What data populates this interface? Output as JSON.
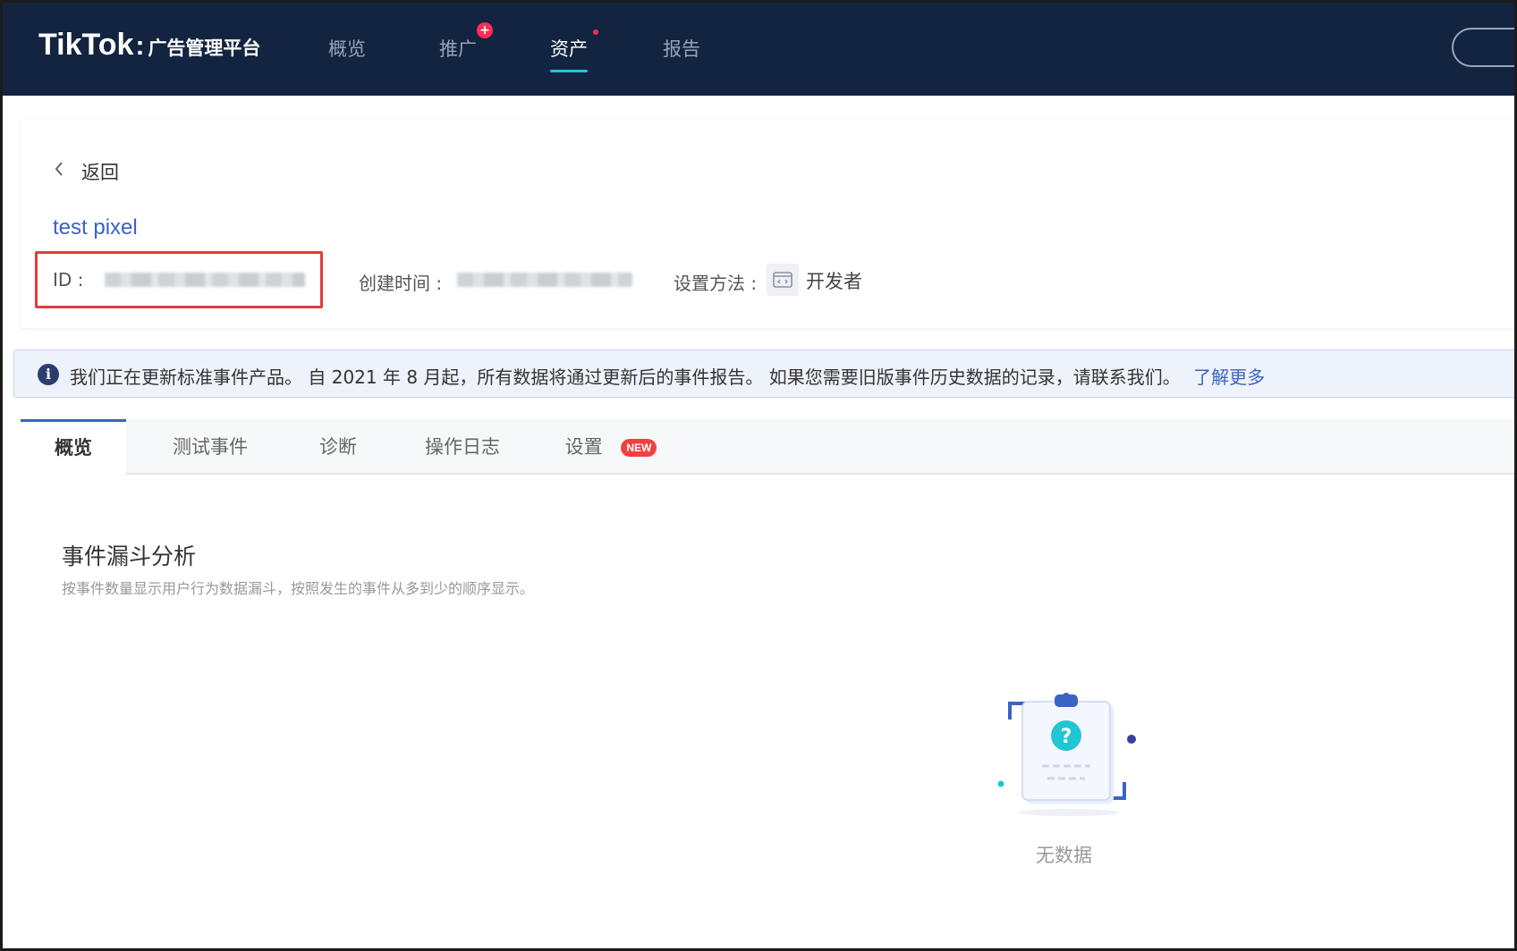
{
  "app": {
    "logo_main": "TikTok",
    "logo_sep": ":",
    "logo_sub": "广告管理平台"
  },
  "nav": {
    "items": [
      {
        "label": "概览",
        "active": false
      },
      {
        "label": "推广",
        "active": false,
        "badge": "+"
      },
      {
        "label": "资产",
        "active": true,
        "dot": true
      },
      {
        "label": "报告",
        "active": false
      }
    ]
  },
  "header": {
    "back_label": "返回",
    "pixel_name": "test pixel",
    "id_label": "ID :",
    "created_label": "创建时间 :",
    "setup_label": "设置方法 :",
    "setup_value": "开发者"
  },
  "notice": {
    "icon": "info-icon",
    "text": "我们正在更新标准事件产品。 自 2021 年 8 月起，所有数据将通过更新后的事件报告。 如果您需要旧版事件历史数据的记录，请联系我们。",
    "link": "了解更多"
  },
  "tabs": [
    {
      "label": "概览",
      "active": true
    },
    {
      "label": "测试事件",
      "active": false
    },
    {
      "label": "诊断",
      "active": false
    },
    {
      "label": "操作日志",
      "active": false
    },
    {
      "label": "设置",
      "active": false,
      "badge": "NEW"
    }
  ],
  "funnel": {
    "title": "事件漏斗分析",
    "description": "按事件数量显示用户行为数据漏斗，按照发生的事件从多到少的顺序显示。"
  },
  "empty_state": {
    "icon": "clipboard-question-icon",
    "text": "无数据"
  },
  "colors": {
    "nav_bg": "#132440",
    "accent": "#21c6d3",
    "link": "#3b63c4",
    "badge_red": "#fe2c55",
    "highlight_border": "#e33b3b"
  }
}
